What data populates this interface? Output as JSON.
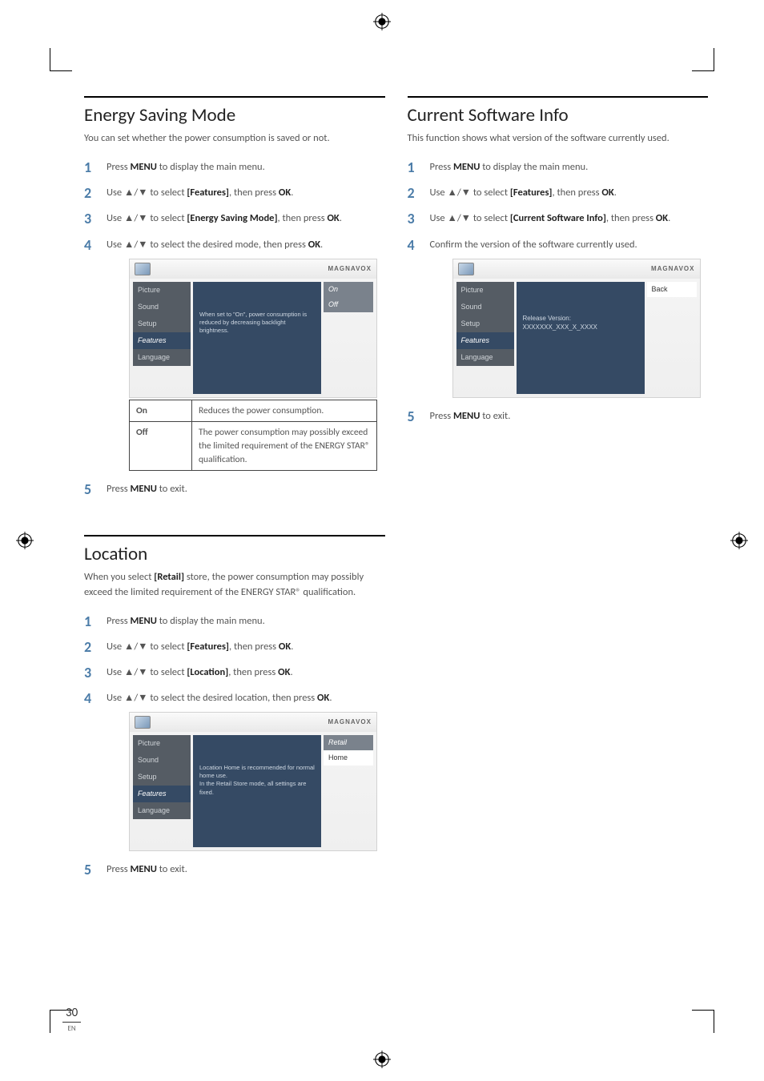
{
  "page": {
    "number": "30",
    "lang": "EN"
  },
  "regmark": "registration-mark",
  "energy": {
    "heading": "Energy Saving Mode",
    "intro": "You can set whether the power consumption is saved or not.",
    "steps": {
      "s1a": "Press ",
      "s1b": "MENU",
      "s1c": " to display the main menu.",
      "s2a": "Use ▲/▼ to select ",
      "s2b": "[Features]",
      "s2c": ", then press ",
      "s2d": "OK",
      "s2e": ".",
      "s3a": "Use ▲/▼ to select ",
      "s3b": "[Energy Saving Mode]",
      "s3c": ", then press ",
      "s3d": "OK",
      "s3e": ".",
      "s4a": "Use ▲/▼ to select the desired mode, then press ",
      "s4b": "OK",
      "s4c": ".",
      "s5a": "Press ",
      "s5b": "MENU",
      "s5c": " to exit."
    },
    "osd": {
      "brand": "MAGNAVOX",
      "menu": [
        "Picture",
        "Sound",
        "Setup",
        "Features",
        "Language"
      ],
      "desc": "When set to \"On\", power consumption is reduced by decreasing backlight brightness.",
      "opts": [
        "On",
        "Off"
      ]
    },
    "table": {
      "on_label": "On",
      "on_desc": "Reduces the power consumption.",
      "off_label": "Off",
      "off_desc": "The power consumption may possibly exceed the limited requirement of the ENERGY STAR® qualification."
    }
  },
  "location": {
    "heading": "Location",
    "intro_a": "When you select ",
    "intro_b": "[Retail]",
    "intro_c": " store, the power consumption may possibly exceed the limited requirement of the ENERGY STAR® qualification.",
    "steps": {
      "s1a": "Press ",
      "s1b": "MENU",
      "s1c": " to display the main menu.",
      "s2a": "Use ▲/▼ to select ",
      "s2b": "[Features]",
      "s2c": ", then press ",
      "s2d": "OK",
      "s2e": ".",
      "s3a": "Use ▲/▼ to select ",
      "s3b": "[Location]",
      "s3c": ", then press ",
      "s3d": "OK",
      "s3e": ".",
      "s4a": "Use ▲/▼ to select the desired location, then press ",
      "s4b": "OK",
      "s4c": ".",
      "s5a": "Press ",
      "s5b": "MENU",
      "s5c": " to exit."
    },
    "osd": {
      "brand": "MAGNAVOX",
      "menu": [
        "Picture",
        "Sound",
        "Setup",
        "Features",
        "Language"
      ],
      "desc": "Location Home is recommended for normal home use.\nIn the Retail Store mode, all settings are fixed.",
      "opts": [
        "Retail",
        "Home"
      ]
    }
  },
  "swinfo": {
    "heading": "Current Software Info",
    "intro": "This function shows what version of the software currently used.",
    "steps": {
      "s1a": "Press ",
      "s1b": "MENU",
      "s1c": " to display the main menu.",
      "s2a": "Use ▲/▼ to select ",
      "s2b": "[Features]",
      "s2c": ", then press ",
      "s2d": "OK",
      "s2e": ".",
      "s3a": "Use ▲/▼ to select ",
      "s3b": "[Current Software Info]",
      "s3c": ", then press ",
      "s3d": "OK",
      "s3e": ".",
      "s4": "Confirm the version of the software currently used.",
      "s5a": "Press ",
      "s5b": "MENU",
      "s5c": " to exit."
    },
    "osd": {
      "brand": "MAGNAVOX",
      "menu": [
        "Picture",
        "Sound",
        "Setup",
        "Features",
        "Language"
      ],
      "ver_label": "Release Version:",
      "ver_value": "XXXXXXX_XXX_X_XXXX",
      "opts": [
        "Back"
      ]
    }
  }
}
